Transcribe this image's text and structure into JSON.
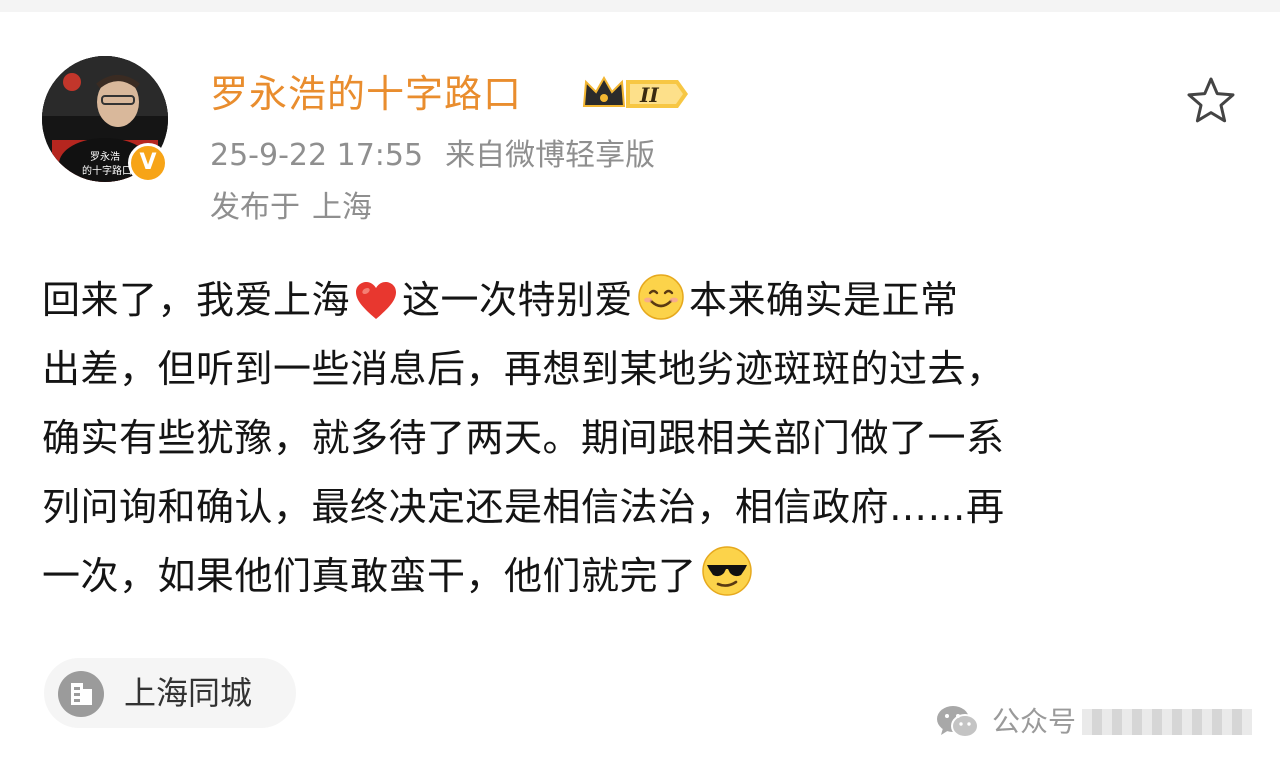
{
  "post": {
    "author": {
      "name": "罗永浩的十字路口",
      "verified_mark": "V",
      "membership_badge": "II",
      "avatar_caption": [
        "罗永浩",
        "的十字路口"
      ]
    },
    "meta": {
      "timestamp": "25-9-22 17:55",
      "source": "来自微博轻享版",
      "location_prefix": "发布于",
      "location": "上海"
    },
    "body": {
      "lines": [
        [
          "回来了，我爱上海",
          "heart",
          "这一次特别爱",
          "smile",
          "本来确实是正常"
        ],
        [
          "出差，但听到一些消息后，再想到某地劣迹斑斑的过去，"
        ],
        [
          "确实有些犹豫，就多待了两天。期间跟相关部门做了一系"
        ],
        [
          "列问询和确认，最终决定还是相信法治，相信政府……再"
        ],
        [
          "一次，如果他们真敢蛮干，他们就完了",
          "cool"
        ]
      ]
    },
    "location_tag": {
      "label": "上海同城",
      "icon": "building-icon"
    },
    "favorite_icon": "star-outline-icon"
  },
  "watermark": {
    "icon": "wechat-icon",
    "text": "公众号"
  },
  "colors": {
    "username": "#e98d2e",
    "meta": "#8f8f8f",
    "body_text": "#141414",
    "verified": "#f7a417",
    "chip_bg": "#f5f5f5"
  }
}
